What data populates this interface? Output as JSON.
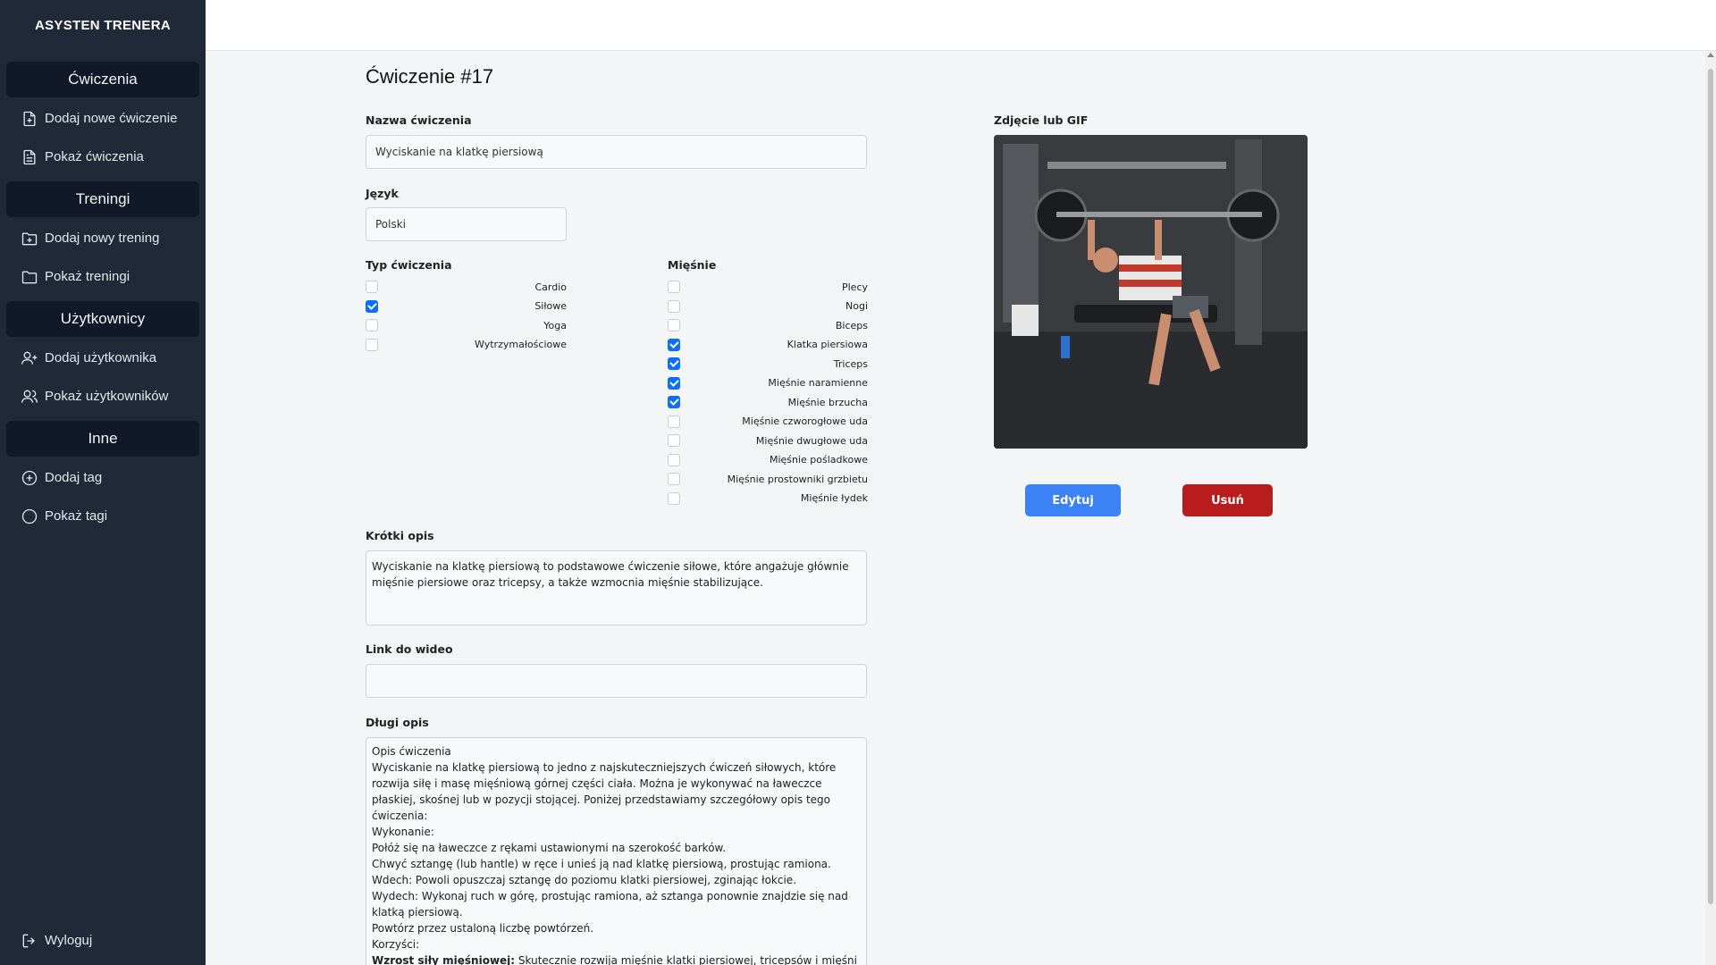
{
  "sidebar": {
    "brand": "ASYSTEN TRENERA",
    "sections": [
      {
        "title": "Ćwiczenia",
        "items": [
          {
            "label": "Dodaj nowe ćwiczenie",
            "icon": "file-plus-icon"
          },
          {
            "label": "Pokaż ćwiczenia",
            "icon": "file-text-icon"
          }
        ]
      },
      {
        "title": "Treningi",
        "items": [
          {
            "label": "Dodaj nowy trening",
            "icon": "folder-plus-icon"
          },
          {
            "label": "Pokaż treningi",
            "icon": "folder-icon"
          }
        ]
      },
      {
        "title": "Użytkownicy",
        "items": [
          {
            "label": "Dodaj użytkownika",
            "icon": "user-plus-icon"
          },
          {
            "label": "Pokaż użytkowników",
            "icon": "users-icon"
          }
        ]
      },
      {
        "title": "Inne",
        "items": [
          {
            "label": "Dodaj tag",
            "icon": "plus-circle-icon"
          },
          {
            "label": "Pokaż tagi",
            "icon": "circle-icon"
          }
        ]
      }
    ],
    "logout": "Wyloguj"
  },
  "page": {
    "title": "Ćwiczenie #17",
    "name_label": "Nazwa ćwiczenia",
    "name_value": "Wyciskanie na klatkę piersiową",
    "lang_label": "Język",
    "lang_value": "Polski",
    "type_label": "Typ ćwiczenia",
    "types": [
      {
        "label": "Cardio",
        "checked": false
      },
      {
        "label": "Siłowe",
        "checked": true
      },
      {
        "label": "Yoga",
        "checked": false
      },
      {
        "label": "Wytrzymałościowe",
        "checked": false
      }
    ],
    "muscles_label": "Mięśnie",
    "muscles": [
      {
        "label": "Plecy",
        "checked": false
      },
      {
        "label": "Nogi",
        "checked": false
      },
      {
        "label": "Biceps",
        "checked": false
      },
      {
        "label": "Klatka piersiowa",
        "checked": true
      },
      {
        "label": "Triceps",
        "checked": true
      },
      {
        "label": "Mięśnie naramienne",
        "checked": true
      },
      {
        "label": "Mięśnie brzucha",
        "checked": true
      },
      {
        "label": "Mięśnie czworogłowe uda",
        "checked": false
      },
      {
        "label": "Mięśnie dwugłowe uda",
        "checked": false
      },
      {
        "label": "Mięśnie pośladkowe",
        "checked": false
      },
      {
        "label": "Mięśnie prostowniki grzbietu",
        "checked": false
      },
      {
        "label": "Mięśnie łydek",
        "checked": false
      }
    ],
    "short_desc_label": "Krótki opis",
    "short_desc": "Wyciskanie na klatkę piersiową to podstawowe ćwiczenie siłowe, które angażuje głównie mięśnie piersiowe oraz tricepsy, a także wzmocnia mięśnie stabilizujące.",
    "video_label": "Link do wideo",
    "video_value": "",
    "long_desc_label": "Długi opis",
    "long_desc": [
      "Opis ćwiczenia",
      "Wyciskanie na klatkę piersiową to jedno z najskuteczniejszych ćwiczeń siłowych, które rozwija siłę i masę mięśniową górnej części ciała. Można je wykonywać na ławeczce płaskiej, skośnej lub w pozycji stojącej. Poniżej przedstawiamy szczegółowy opis tego ćwiczenia:",
      "Wykonanie:",
      "Połóż się na ławeczce z rękami ustawionymi na szerokość barków.",
      "Chwyć sztangę (lub hantle) w ręce i unieś ją nad klatkę piersiową, prostując ramiona.",
      "Wdech: Powoli opuszczaj sztangę do poziomu klatki piersiowej, zginając łokcie.",
      "Wydech: Wykonaj ruch w górę, prostując ramiona, aż sztanga ponownie znajdzie się nad klatką piersiową.",
      "Powtórz przez ustaloną liczbę powtórzeń.",
      "Korzyści:"
    ],
    "long_desc_bold": "Wzrost siły mięśniowej:",
    "long_desc_bold_rest": " Skutecznie rozwija mięśnie klatki piersiowej, tricepsów i mięśni naramiennych.",
    "photo_label": "Zdjęcie lub GIF",
    "edit_button": "Edytuj",
    "delete_button": "Usuń"
  }
}
